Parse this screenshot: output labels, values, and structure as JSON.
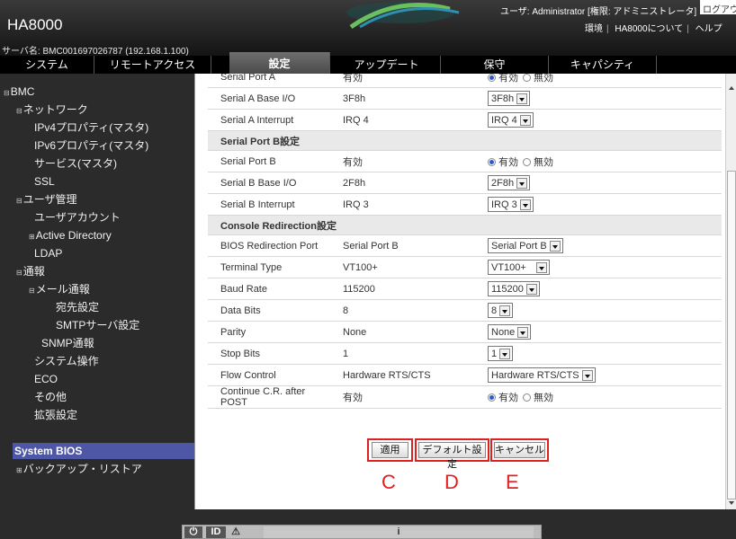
{
  "header": {
    "app_title": "HA8000",
    "server_name": "サーバ名: BMC001697026787 (192.168.1.100)",
    "user_info": "ユーザ: Administrator [権限: アドミニストレータ]",
    "logout_label": "ログアウト",
    "links": [
      "環境",
      "HA8000について",
      "ヘルプ"
    ]
  },
  "tabs": [
    {
      "label": "システム"
    },
    {
      "label": "リモートアクセス"
    },
    {
      "label": "設定",
      "active": true
    },
    {
      "label": "アップデート"
    },
    {
      "label": "保守"
    },
    {
      "label": "キャパシティ"
    }
  ],
  "sidebar": {
    "items": [
      {
        "label": "BMC",
        "expander": "⊟"
      },
      {
        "label": "ネットワーク",
        "expander": "⊟"
      },
      {
        "label": "IPv4プロパティ(マスタ)"
      },
      {
        "label": "IPv6プロパティ(マスタ)"
      },
      {
        "label": "サービス(マスタ)"
      },
      {
        "label": "SSL"
      },
      {
        "label": "ユーザ管理",
        "expander": "⊟"
      },
      {
        "label": "ユーザアカウント"
      },
      {
        "label": "Active Directory",
        "expander": "⊞"
      },
      {
        "label": "LDAP"
      },
      {
        "label": "通報",
        "expander": "⊟"
      },
      {
        "label": "メール通報",
        "expander": "⊟"
      },
      {
        "label": "宛先設定"
      },
      {
        "label": "SMTPサーバ設定"
      },
      {
        "label": "SNMP通報"
      },
      {
        "label": "システム操作"
      },
      {
        "label": "ECO"
      },
      {
        "label": "その他"
      },
      {
        "label": "拡張設定"
      },
      {
        "label": "System BIOS",
        "selected": true
      },
      {
        "label": "バックアップ・リストア",
        "expander": "⊞"
      }
    ]
  },
  "table": {
    "rows": [
      {
        "type": "row",
        "name": "Serial Port A",
        "value": "有効",
        "control": "radio",
        "radio_on": "有効",
        "radio_off": "無効"
      },
      {
        "type": "row",
        "name": "Serial A Base I/O",
        "value": "3F8h",
        "control": "select",
        "selected": "3F8h"
      },
      {
        "type": "row",
        "name": "Serial A Interrupt",
        "value": "IRQ 4",
        "control": "select",
        "selected": "IRQ 4"
      },
      {
        "type": "section",
        "name": "Serial Port B設定"
      },
      {
        "type": "row",
        "name": "Serial Port B",
        "value": "有効",
        "control": "radio",
        "radio_on": "有効",
        "radio_off": "無効"
      },
      {
        "type": "row",
        "name": "Serial B Base I/O",
        "value": "2F8h",
        "control": "select",
        "selected": "2F8h"
      },
      {
        "type": "row",
        "name": "Serial B Interrupt",
        "value": "IRQ 3",
        "control": "select",
        "selected": "IRQ 3"
      },
      {
        "type": "section",
        "name": "Console Redirection設定"
      },
      {
        "type": "row",
        "name": "BIOS Redirection Port",
        "value": "Serial Port B",
        "control": "select",
        "selected": "Serial Port B"
      },
      {
        "type": "row",
        "name": "Terminal Type",
        "value": "VT100+",
        "control": "select",
        "selected": "VT100+"
      },
      {
        "type": "row",
        "name": "Baud Rate",
        "value": "115200",
        "control": "select",
        "selected": "115200"
      },
      {
        "type": "row",
        "name": "Data Bits",
        "value": "8",
        "control": "select",
        "selected": "8"
      },
      {
        "type": "row",
        "name": "Parity",
        "value": "None",
        "control": "select",
        "selected": "None"
      },
      {
        "type": "row",
        "name": "Stop Bits",
        "value": "1",
        "control": "select",
        "selected": "1"
      },
      {
        "type": "row",
        "name": "Flow Control",
        "value": "Hardware RTS/CTS",
        "control": "select",
        "selected": "Hardware RTS/CTS"
      },
      {
        "type": "row",
        "name": "Continue C.R. after POST",
        "value": "有効",
        "control": "radio",
        "radio_on": "有効",
        "radio_off": "無効"
      }
    ]
  },
  "buttons": {
    "apply": "適用",
    "default": "デフォルト設定",
    "cancel": "キャンセル"
  },
  "annotations": [
    "C",
    "D",
    "E"
  ],
  "footer": {
    "icons": [
      "power-icon",
      "id-icon",
      "alert-icon"
    ],
    "status_text": "i"
  },
  "colors": {
    "selected_nav": "#4d57a6",
    "annotation_red": "#e02020"
  }
}
